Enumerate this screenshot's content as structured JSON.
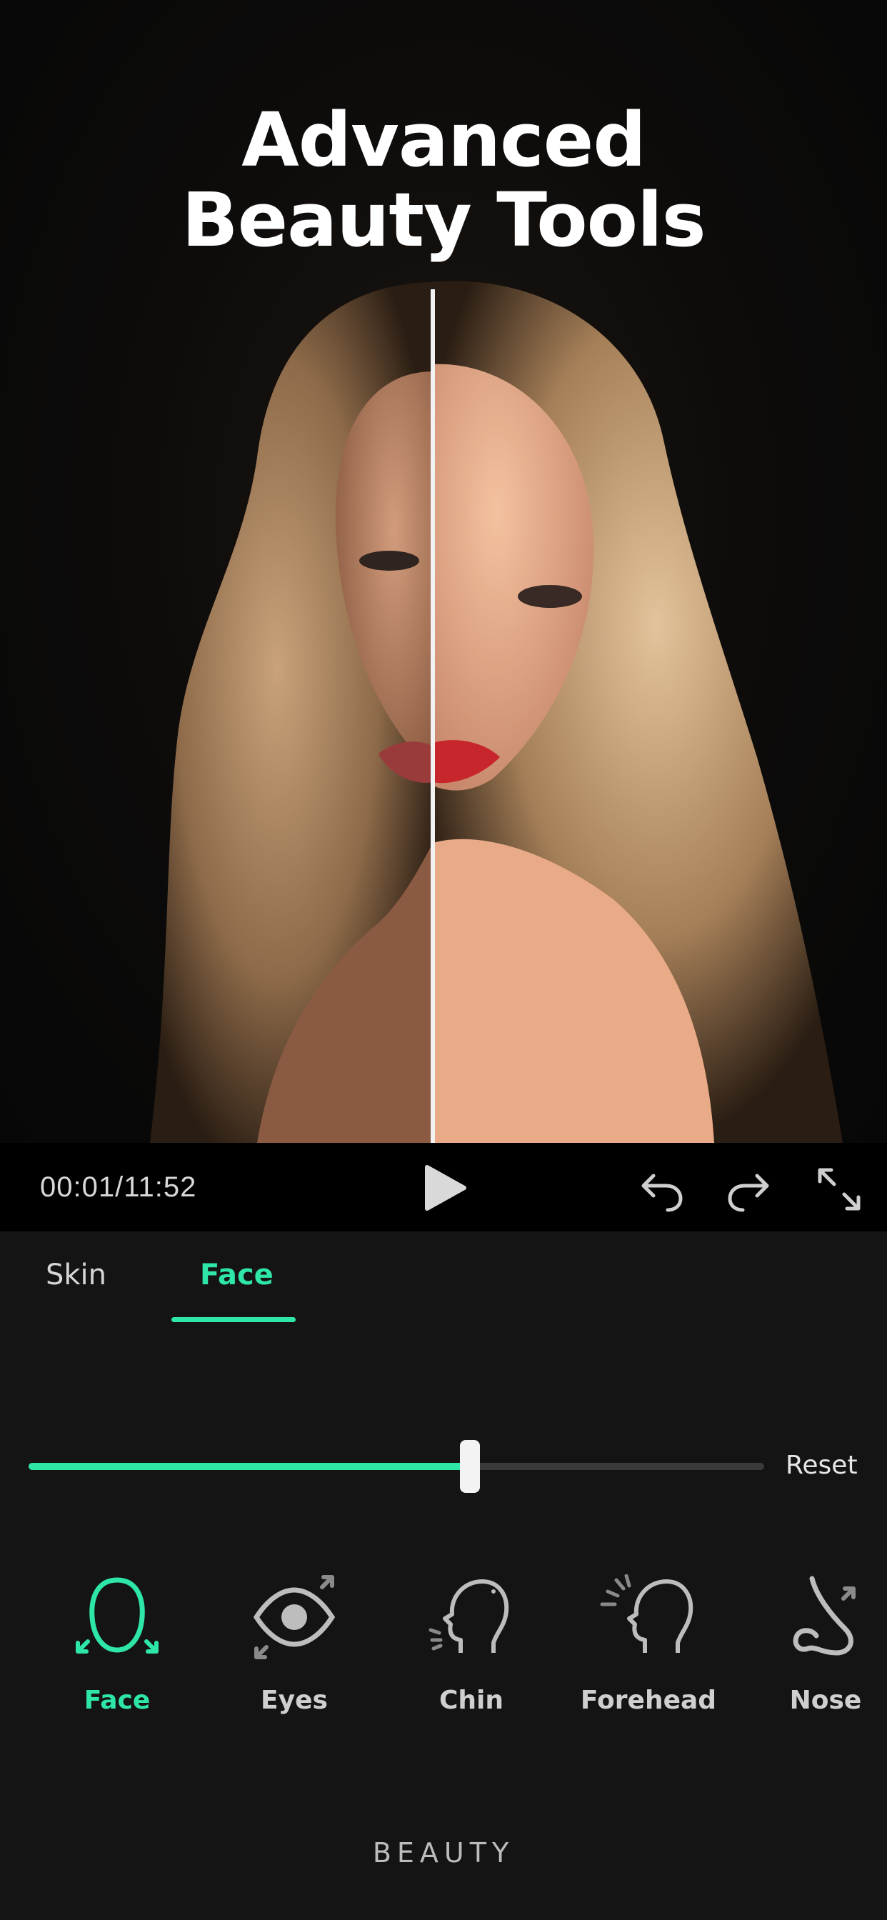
{
  "hero": {
    "headline_line1": "Advanced",
    "headline_line2": "Beauty Tools"
  },
  "player": {
    "time": "00:01/11:52",
    "play_icon": "play-icon",
    "undo_icon": "undo-icon",
    "redo_icon": "redo-icon",
    "fullscreen_icon": "expand-icon"
  },
  "tabs": [
    {
      "label": "Skin",
      "active": false
    },
    {
      "label": "Face",
      "active": true
    }
  ],
  "slider": {
    "value_fraction": 0.6,
    "reset_label": "Reset"
  },
  "tools": [
    {
      "label": "Face",
      "icon": "face-outline-icon",
      "active": true
    },
    {
      "label": "Eyes",
      "icon": "eye-icon",
      "active": false
    },
    {
      "label": "Chin",
      "icon": "chin-profile-icon",
      "active": false
    },
    {
      "label": "Forehead",
      "icon": "forehead-profile-icon",
      "active": false
    },
    {
      "label": "Nose",
      "icon": "nose-icon",
      "active": false
    }
  ],
  "section_label": "BEAUTY",
  "colors": {
    "accent": "#2ee6a6",
    "background": "#141414",
    "playbar": "#000000"
  }
}
